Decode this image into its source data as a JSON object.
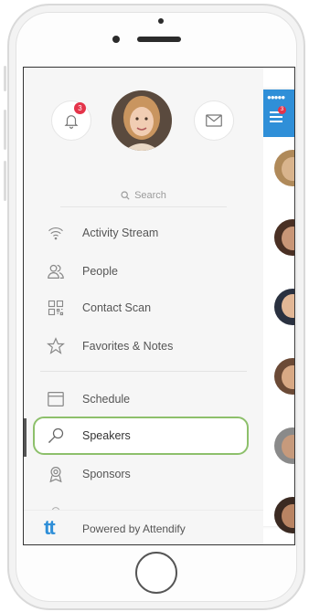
{
  "header": {
    "notification_count": "3",
    "icons": [
      "bell-icon",
      "mail-icon"
    ]
  },
  "search": {
    "placeholder": "Search"
  },
  "menu": {
    "items": [
      {
        "label": "Activity Stream",
        "icon": "wifi-icon"
      },
      {
        "label": "People",
        "icon": "people-icon"
      },
      {
        "label": "Contact Scan",
        "icon": "qr-scan-icon"
      },
      {
        "label": "Favorites & Notes",
        "icon": "star-icon"
      },
      {
        "label": "Schedule",
        "icon": "calendar-icon"
      },
      {
        "label": "Speakers",
        "icon": "microphone-icon",
        "active": true
      },
      {
        "label": "Sponsors",
        "icon": "sponsor-badge-icon"
      }
    ]
  },
  "footer": {
    "logo": "tt",
    "text": "Powered by Attendify"
  },
  "main": {
    "menu_badge": "3"
  },
  "colors": {
    "accent": "#2f8fd8",
    "highlight": "#8dc06b",
    "badge": "#e4344a"
  }
}
